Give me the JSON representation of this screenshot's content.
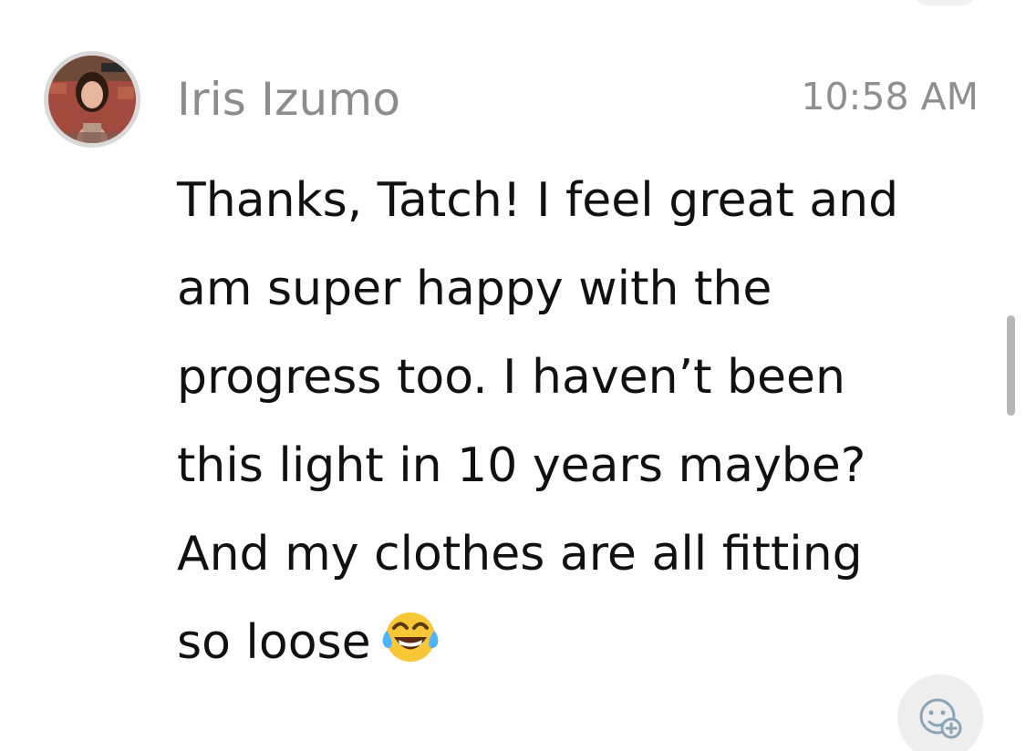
{
  "message": {
    "sender_name": "Iris Izumo",
    "timestamp": "10:58 AM",
    "text": "Thanks, Tatch! I feel great and\nam super happy with the\nprogress too. I haven’t been\nthis light in 10 years maybe?\nAnd my clothes are all fitting\nso loose",
    "emoji": "face-with-tears-of-joy",
    "avatar_icon": "profile-photo"
  },
  "controls": {
    "reaction_icon": "add-reaction-icon"
  },
  "colors": {
    "background": "#ffffff",
    "name": "#8c8c8c",
    "timestamp": "#8f8f8f",
    "text": "#111111",
    "scrollbar": "#b6b6b6",
    "reaction_bg": "#eeeeee"
  }
}
